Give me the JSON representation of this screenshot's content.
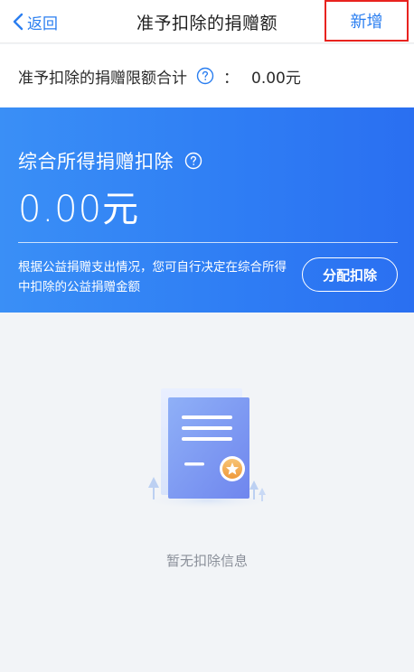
{
  "navbar": {
    "back_label": "返回",
    "title": "准予扣除的捐赠额",
    "add_label": "新增"
  },
  "summary": {
    "label": "准予扣除的捐赠限额合计",
    "separator": "：",
    "value": "0.00元"
  },
  "card": {
    "title": "综合所得捐赠扣除",
    "amount": "0.00元",
    "description": "根据公益捐赠支出情况，您可自行决定在综合所得中扣除的公益捐赠金额",
    "allocate_label": "分配扣除"
  },
  "empty_state": {
    "message": "暂无扣除信息",
    "icon": "document-badge-icon"
  },
  "colors": {
    "accent": "#2a7ef0",
    "highlight_border": "#e8231f",
    "card_gradient_start": "#3a8ff6",
    "card_gradient_end": "#2a6ff1"
  }
}
